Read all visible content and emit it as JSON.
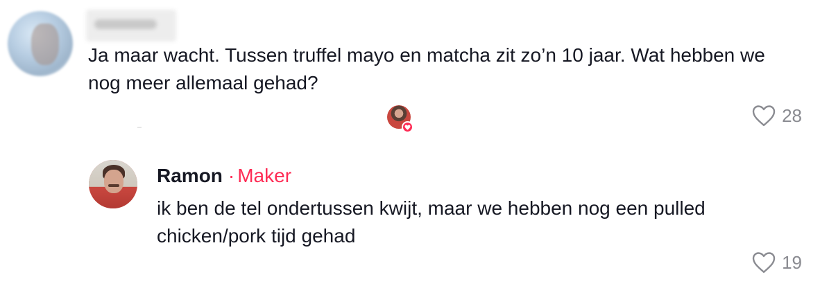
{
  "comment": {
    "text": "Ja maar wacht. Tussen truffel mayo en matcha zit zo’n 10 jaar. Wat hebben we nog meer allemaal gehad?",
    "likes": "28",
    "liked_by_creator": true
  },
  "reply": {
    "author": "Ramon",
    "separator": "·",
    "role": "Maker",
    "text": "ik ben de tel ondertussen kwijt, maar we hebben nog een pulled chicken/pork tijd gehad",
    "likes": "19"
  },
  "colors": {
    "accent": "#fe2c55",
    "text": "#161823",
    "muted": "#8a8b91"
  },
  "icons": {
    "like": "heart-outline-icon",
    "creator_like_badge": "heart-filled-icon"
  }
}
